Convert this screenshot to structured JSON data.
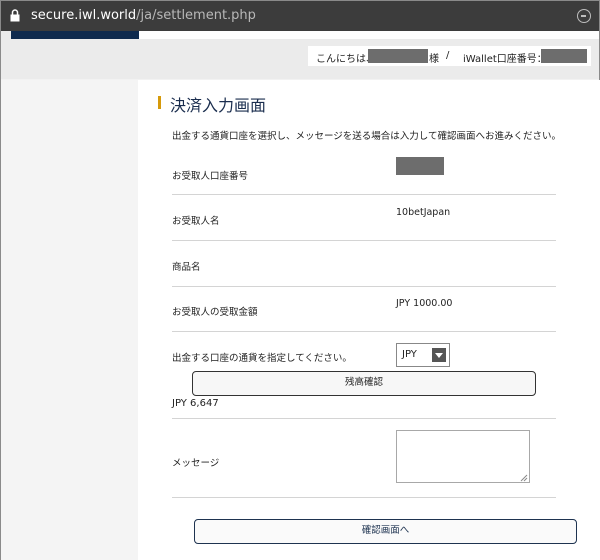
{
  "browser": {
    "url_host": "secure.iwl.world",
    "url_path": "/ja/settlement.php"
  },
  "header": {
    "greeting": "こんにちは、",
    "honorific": "様",
    "separator": "/",
    "account_label": "iWallet口座番号："
  },
  "page": {
    "title": "決済入力画面",
    "intro": "出金する通貨口座を選択し、メッセージを送る場合は入力して確認画面へお進みください。"
  },
  "form": {
    "recipient_account_label": "お受取人口座番号",
    "recipient_name_label": "お受取人名",
    "recipient_name_value": "10betJapan",
    "product_name_label": "商品名",
    "recipient_amount_label": "お受取人の受取金額",
    "recipient_amount_value": "JPY 1000.00",
    "currency_label": "出金する口座の通貨を指定してください。",
    "currency_selected": "JPY",
    "balance_button_label": "残高確認",
    "balance_value": "JPY 6,647",
    "message_label": "メッセージ",
    "confirm_button_label": "確認画面へ"
  },
  "colors": {
    "header_navy": "#0f2a4d",
    "title_accent": "#d69a0b",
    "title_text": "#1a2d4e"
  }
}
